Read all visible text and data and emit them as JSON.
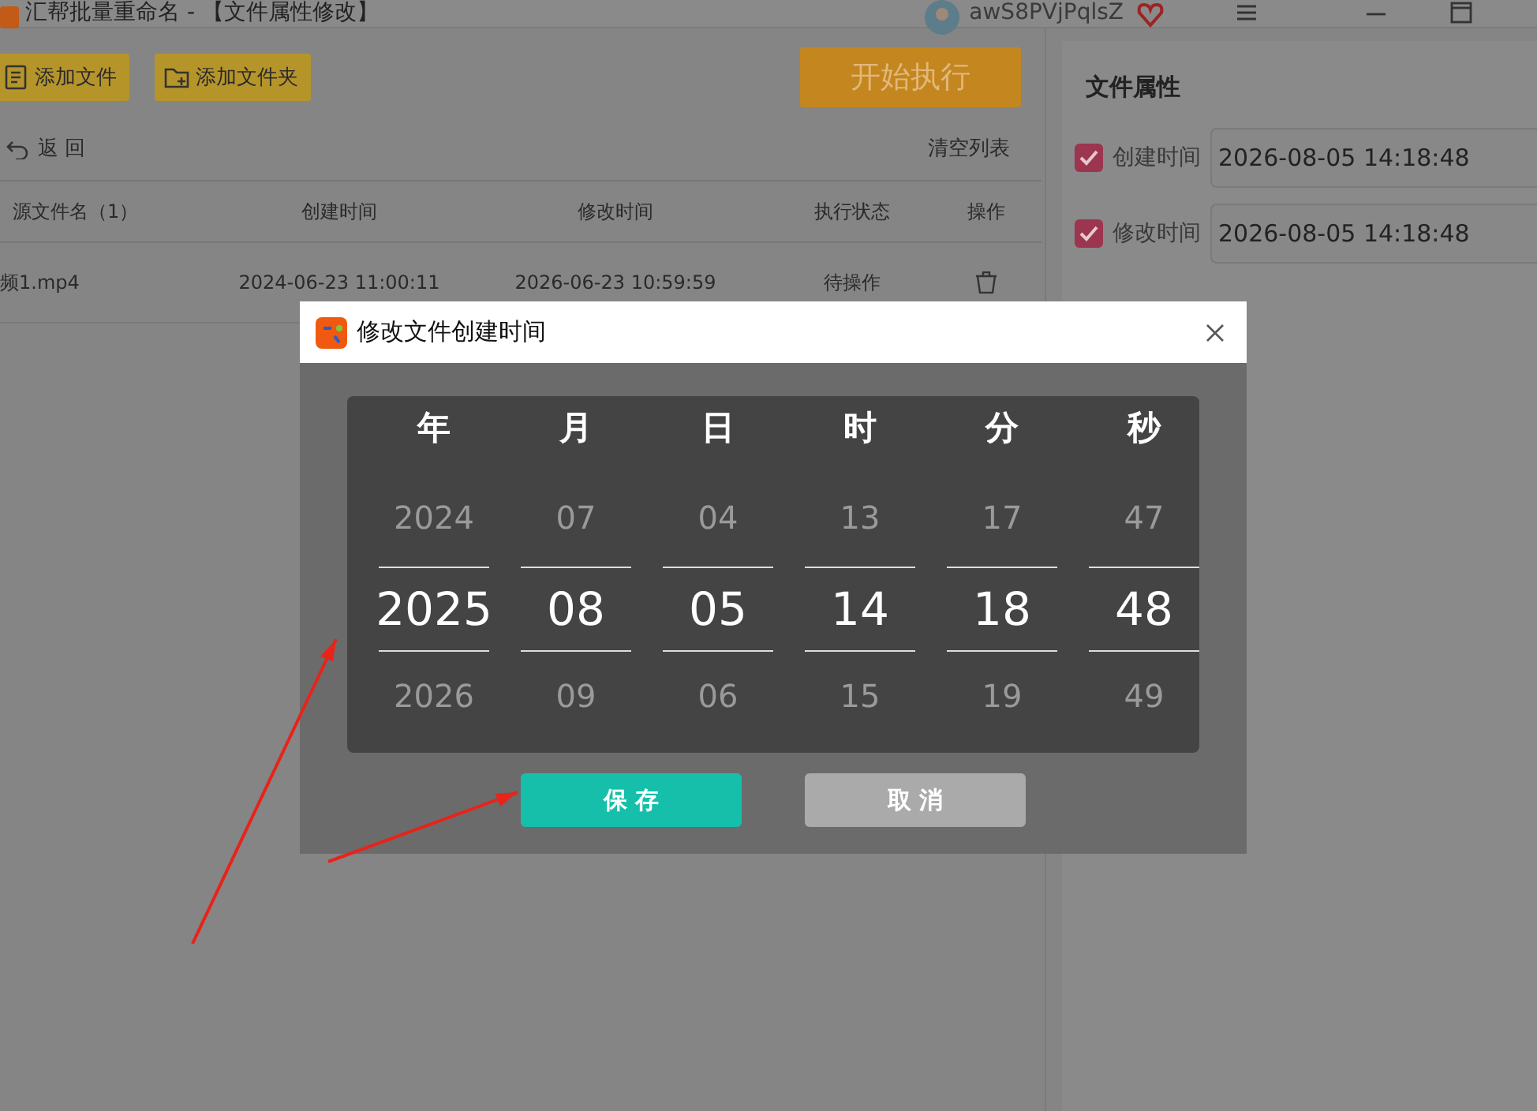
{
  "window": {
    "title": "汇帮批量重命名 - 【文件属性修改】",
    "username": "awS8PVjPqlsZ"
  },
  "toolbar": {
    "buttons": [
      "添加文件",
      "添加文件夹"
    ],
    "start_button": "开始执行"
  },
  "nav": {
    "back": "返 回",
    "clear": "清空列表"
  },
  "table": {
    "columns": [
      "源文件名（1）",
      "创建时间",
      "修改时间",
      "执行状态",
      "操作"
    ],
    "rows": [
      {
        "name": "频1.mp4",
        "created": "2024-06-23 11:00:11",
        "modified": "2026-06-23 10:59:59",
        "status": "待操作"
      }
    ]
  },
  "properties": {
    "title": "文件属性",
    "items": [
      {
        "label": "创建时间",
        "checked": true,
        "value": "2026-08-05 14:18:48"
      },
      {
        "label": "修改时间",
        "checked": true,
        "value": "2026-08-05 14:18:48"
      }
    ]
  },
  "dialog": {
    "title": "修改文件创建时间",
    "columns": [
      {
        "header": "年",
        "prev": "2024",
        "current": "2025",
        "next": "2026"
      },
      {
        "header": "月",
        "prev": "07",
        "current": "08",
        "next": "09"
      },
      {
        "header": "日",
        "prev": "04",
        "current": "05",
        "next": "06"
      },
      {
        "header": "时",
        "prev": "13",
        "current": "14",
        "next": "15"
      },
      {
        "header": "分",
        "prev": "17",
        "current": "18",
        "next": "19"
      },
      {
        "header": "秒",
        "prev": "47",
        "current": "48",
        "next": "49"
      }
    ],
    "save": "保 存",
    "cancel": "取 消"
  }
}
